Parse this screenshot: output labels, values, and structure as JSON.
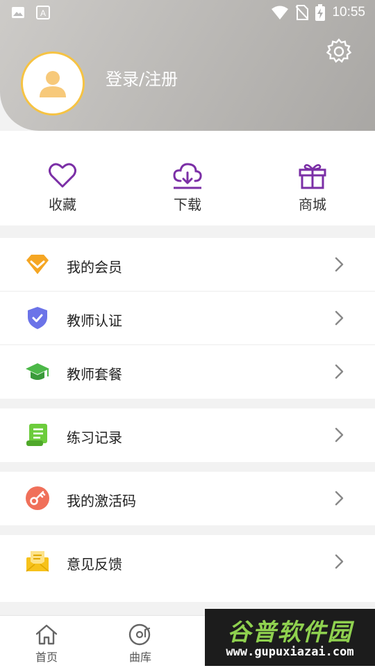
{
  "status_bar": {
    "time": "10:55",
    "icons": [
      "image-icon",
      "text-a-icon",
      "wifi-icon",
      "no-sim-icon",
      "battery-charging-icon"
    ]
  },
  "profile": {
    "login_label": "登录/注册",
    "avatar_icon": "user-icon",
    "settings_icon": "gear-icon",
    "avatar_border_color": "#f6c343"
  },
  "quick_actions": [
    {
      "label": "收藏",
      "icon": "heart-icon"
    },
    {
      "label": "下载",
      "icon": "cloud-download-icon"
    },
    {
      "label": "商城",
      "icon": "gift-icon"
    }
  ],
  "accent_color": "#7b2fa6",
  "menu_groups": [
    {
      "items": [
        {
          "label": "我的会员",
          "icon": "diamond-icon",
          "color": "#f5a623"
        },
        {
          "label": "教师认证",
          "icon": "shield-check-icon",
          "color": "#6b73e8"
        },
        {
          "label": "教师套餐",
          "icon": "graduation-cap-icon",
          "color": "#4cb848"
        }
      ]
    },
    {
      "items": [
        {
          "label": "练习记录",
          "icon": "scroll-icon",
          "color": "#6ccc3c"
        }
      ]
    },
    {
      "items": [
        {
          "label": "我的激活码",
          "icon": "key-icon",
          "color": "#f0705a"
        }
      ]
    },
    {
      "items": [
        {
          "label": "意见反馈",
          "icon": "mail-icon",
          "color": "#f7c21b"
        }
      ]
    }
  ],
  "tab_bar": [
    {
      "label": "首页",
      "icon": "home-icon"
    },
    {
      "label": "曲库",
      "icon": "disc-icon"
    }
  ],
  "watermark": {
    "logo": "谷普软件园",
    "url": "www.gupuxiazai.com"
  }
}
